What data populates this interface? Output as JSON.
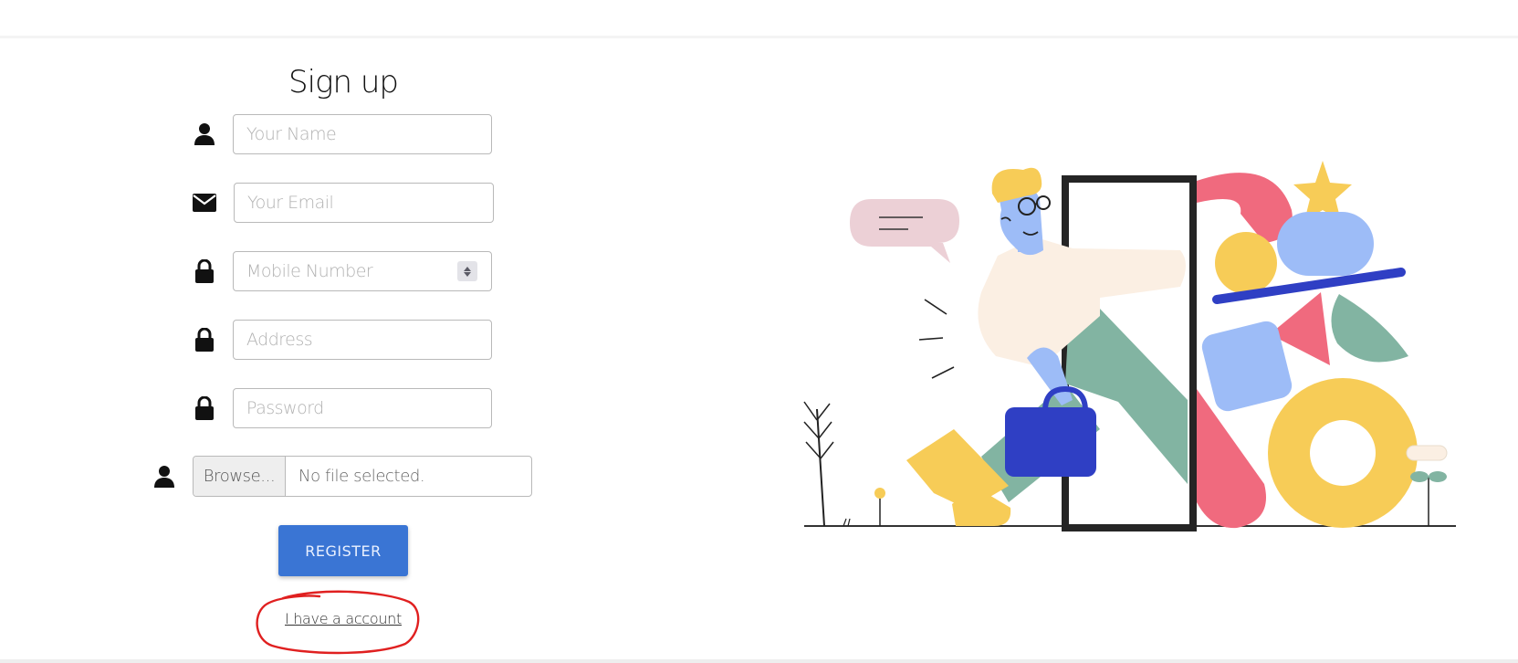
{
  "form": {
    "title": "Sign up",
    "fields": {
      "name": {
        "placeholder": "Your Name",
        "icon": "user-icon"
      },
      "email": {
        "placeholder": "Your Email",
        "icon": "envelope-icon"
      },
      "mobile": {
        "placeholder": "Mobile Number",
        "icon": "lock-icon"
      },
      "address": {
        "placeholder": "Address",
        "icon": "lock-icon"
      },
      "password": {
        "placeholder": "Password",
        "icon": "lock-icon"
      }
    },
    "file": {
      "icon": "user-icon",
      "browse_label": "Browse...",
      "status": "No file selected."
    },
    "register_label": "REGISTER",
    "account_link": "I have a account"
  },
  "colors": {
    "primary": "#3a75d4",
    "annotation": "#e02020",
    "illustration": {
      "pink": "#f06a7e",
      "yellow": "#f7cc57",
      "blue": "#9dbcf7",
      "navy": "#2f3fc4",
      "green": "#82b4a2",
      "cream": "#fbefe3",
      "bubble": "#ecd0d6"
    }
  }
}
